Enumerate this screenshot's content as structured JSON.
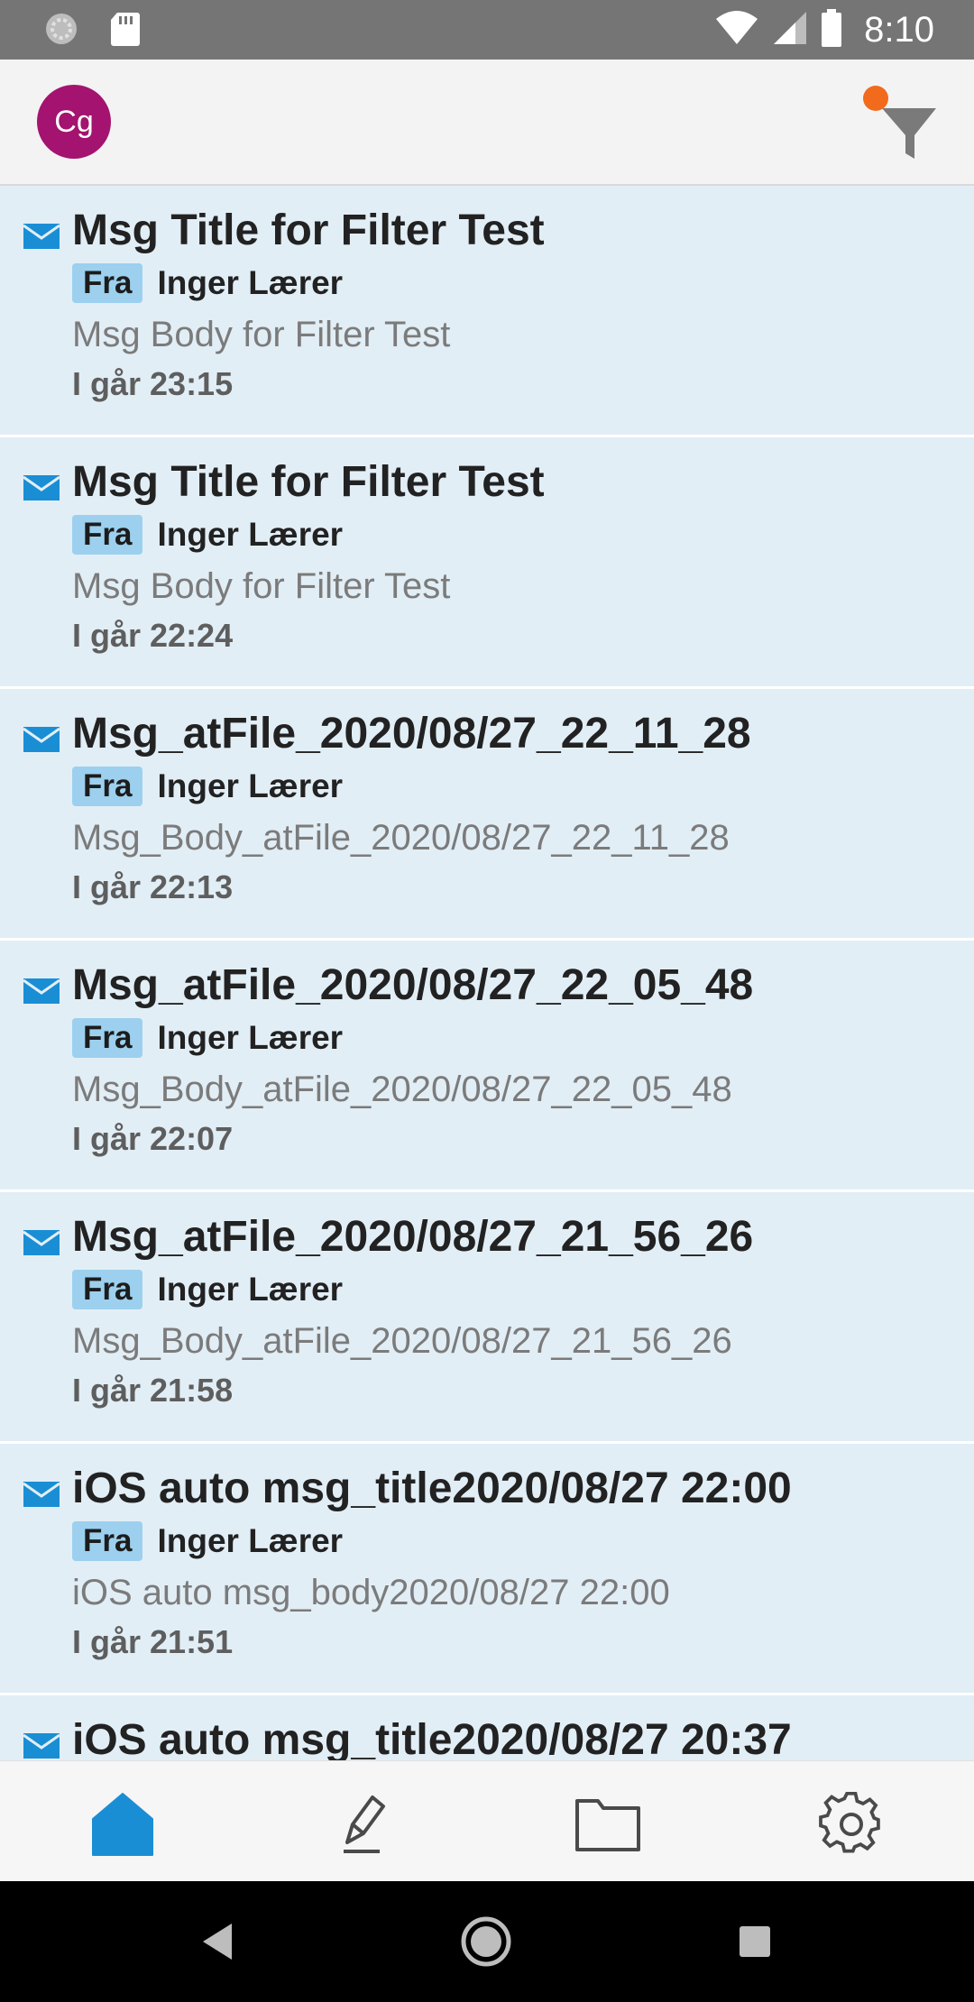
{
  "status_bar": {
    "time": "8:10",
    "icons": [
      "sync-icon",
      "sd-card-icon",
      "wifi-icon",
      "cell-signal-icon",
      "battery-icon"
    ]
  },
  "header": {
    "avatar_initials": "Cg",
    "filter_active_color": "#f26a1b",
    "avatar_color": "#a3136f"
  },
  "messages": [
    {
      "title": "Msg Title for Filter Test",
      "from_label": "Fra",
      "sender": "Inger Lærer",
      "body": "Msg Body for Filter Test",
      "time": "I går 23:15"
    },
    {
      "title": "Msg Title for Filter Test",
      "from_label": "Fra",
      "sender": "Inger Lærer",
      "body": "Msg Body for Filter Test",
      "time": "I går 22:24"
    },
    {
      "title": "Msg_atFile_2020/08/27_22_11_28",
      "from_label": "Fra",
      "sender": "Inger Lærer",
      "body": "Msg_Body_atFile_2020/08/27_22_11_28",
      "time": "I går 22:13"
    },
    {
      "title": "Msg_atFile_2020/08/27_22_05_48",
      "from_label": "Fra",
      "sender": "Inger Lærer",
      "body": "Msg_Body_atFile_2020/08/27_22_05_48",
      "time": "I går 22:07"
    },
    {
      "title": "Msg_atFile_2020/08/27_21_56_26",
      "from_label": "Fra",
      "sender": "Inger Lærer",
      "body": "Msg_Body_atFile_2020/08/27_21_56_26",
      "time": "I går 21:58"
    },
    {
      "title": "iOS auto msg_title2020/08/27 22:00",
      "from_label": "Fra",
      "sender": "Inger Lærer",
      "body": "iOS auto msg_body2020/08/27 22:00",
      "time": "I går 21:51"
    },
    {
      "title": "iOS auto msg_title2020/08/27 20:37",
      "from_label": "",
      "sender": "",
      "body": "",
      "time": ""
    }
  ],
  "bottom_nav": {
    "items": [
      "home-icon",
      "compose-icon",
      "folder-icon",
      "settings-icon"
    ],
    "active": "home-icon",
    "active_color": "#1a8ed4"
  },
  "system_nav": [
    "back-icon",
    "home-circle-icon",
    "recents-icon"
  ]
}
